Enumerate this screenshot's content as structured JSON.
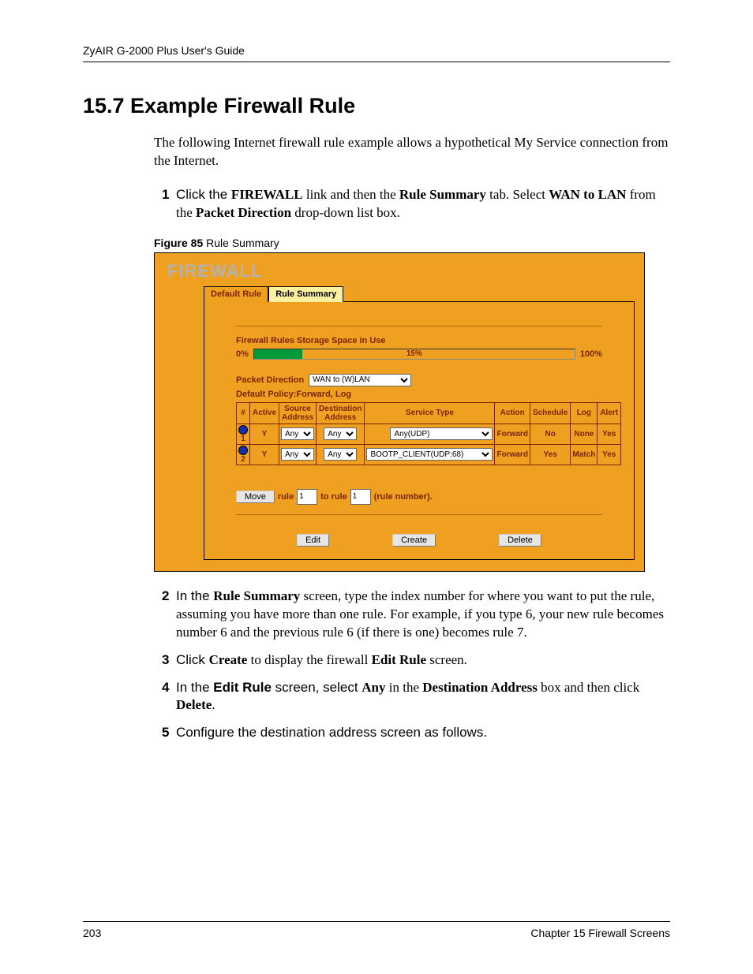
{
  "header": "ZyAIR G-2000 Plus User's Guide",
  "heading": "15.7  Example Firewall Rule",
  "intro": "The following Internet firewall rule example allows a hypothetical My Service connection from the Internet.",
  "step1_pre": "Click the ",
  "step1_b1": "FIREWALL",
  "step1_mid1": " link and then the ",
  "step1_b2": "Rule Summary",
  "step1_mid2": " tab. Select ",
  "step1_b3": "WAN to LAN",
  "step1_mid3": " from the ",
  "step1_b4": "Packet Direction",
  "step1_end": " drop-down list box.",
  "fig_label": "Figure 85",
  "fig_title": "   Rule Summary",
  "ss": {
    "title": "FIREWALL",
    "tab_default": "Default Rule",
    "tab_summary": "Rule Summary",
    "storage_title": "Firewall Rules Storage Space in Use",
    "pct0": "0%",
    "pct15": "15%",
    "pct100": "100%",
    "pd_label": "Packet Direction",
    "pd_value": "WAN to (W)LAN",
    "policy": "Default Policy:Forward, Log",
    "th": {
      "num": "#",
      "active": "Active",
      "src": "Source Address",
      "dst": "Destination Address",
      "svc": "Service Type",
      "action": "Action",
      "sched": "Schedule",
      "log": "Log",
      "alert": "Alert"
    },
    "rows": [
      {
        "num": "1",
        "active": "Y",
        "src": "Any",
        "dst": "Any",
        "svc": "Any(UDP)",
        "action": "Forward",
        "sched": "No",
        "log": "None",
        "alert": "Yes"
      },
      {
        "num": "2",
        "active": "Y",
        "src": "Any",
        "dst": "Any",
        "svc": "BOOTP_CLIENT(UDP:68)",
        "action": "Forward",
        "sched": "Yes",
        "log": "Match",
        "alert": "Yes"
      }
    ],
    "move_btn": "Move",
    "rule_lbl": "rule",
    "rule_val1": "1",
    "to_rule": "to rule",
    "rule_val2": "1",
    "rule_tail": "(rule number).",
    "edit_btn": "Edit",
    "create_btn": "Create",
    "delete_btn": "Delete"
  },
  "step2_pre": "In the ",
  "step2_b1": "Rule Summary",
  "step2_end": " screen, type the index number for where you want to put the rule, assuming you have more than one rule. For example, if you type 6, your new rule becomes number 6 and the previous rule 6 (if there is one) becomes rule 7.",
  "step3_pre": "Click ",
  "step3_b1": "Create",
  "step3_mid": " to display the firewall ",
  "step3_b2": "Edit Rule",
  "step3_end": " screen.",
  "step4_pre": "In the ",
  "step4_b1": "Edit Rule",
  "step4_mid1": " screen, select ",
  "step4_b2": "Any",
  "step4_mid2": " in the ",
  "step4_b3": "Destination Address",
  "step4_mid3": " box and then click ",
  "step4_b4": "Delete",
  "step4_end": ".",
  "step5": "Configure the destination address screen as follows.",
  "footer_left": "203",
  "footer_right": "Chapter 15 Firewall Screens"
}
